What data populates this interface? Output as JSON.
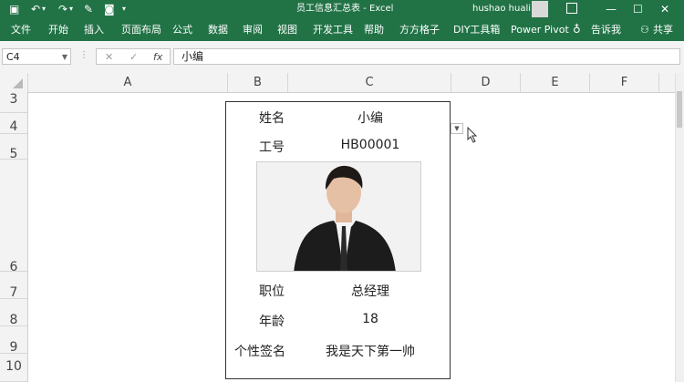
{
  "window": {
    "title": "员工信息汇总表 - Excel",
    "user": "hushao huali",
    "controls": [
      "—",
      "☐",
      "✕"
    ]
  },
  "ribbon": {
    "tabs": [
      "文件",
      "开始",
      "插入",
      "页面布局",
      "公式",
      "数据",
      "审阅",
      "视图",
      "开发工具",
      "帮助",
      "方方格子",
      "DIY工具箱",
      "Power Pivot"
    ],
    "tell_me": "告诉我",
    "share": "共享"
  },
  "formula_bar": {
    "name_box": "C4",
    "fx": "fx",
    "value": "小编"
  },
  "sheet": {
    "columns": [
      "A",
      "B",
      "C",
      "D",
      "E",
      "F"
    ],
    "rows": [
      "3",
      "4",
      "5",
      "6",
      "7",
      "8",
      "9",
      "10"
    ]
  },
  "card": {
    "name_label": "姓名",
    "name_value": "小编",
    "id_label": "工号",
    "id_value": "HB00001",
    "position_label": "职位",
    "position_value": "总经理",
    "age_label": "年龄",
    "age_value": "18",
    "signature_label": "个性签名",
    "signature_value": "我是天下第一帅"
  },
  "colors": {
    "accent": "#217346"
  }
}
